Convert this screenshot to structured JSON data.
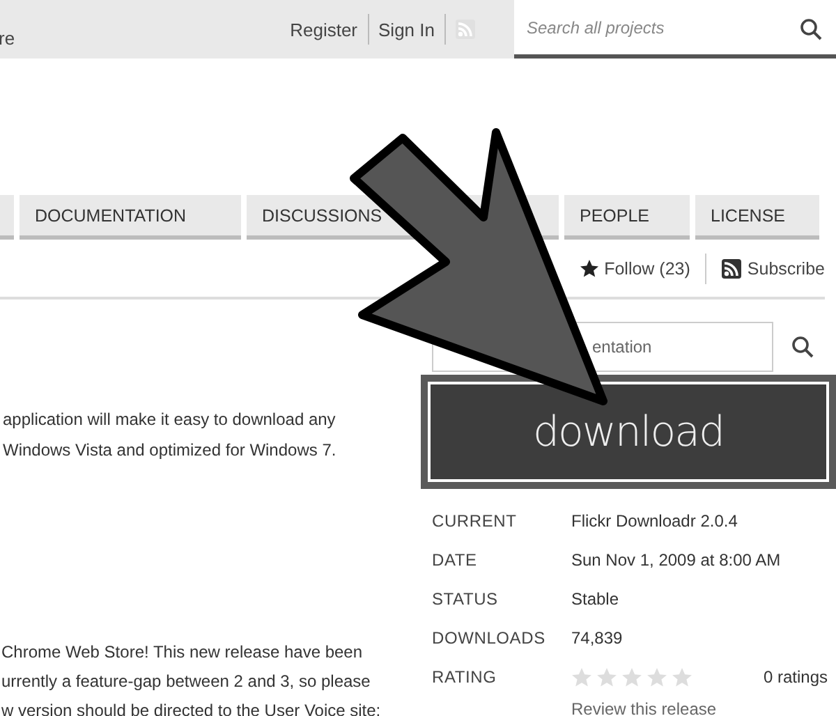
{
  "header": {
    "site_fragment": "re",
    "links": [
      "Register",
      "Sign In"
    ],
    "search": {
      "placeholder": "Search all projects"
    }
  },
  "tabs": [
    {
      "kind": "clipped"
    },
    {
      "kind": "tab",
      "label": "DOCUMENTATION"
    },
    {
      "kind": "tab",
      "label": "DISCUSSIONS"
    },
    {
      "kind": "tab",
      "label": "PEOPLE"
    },
    {
      "kind": "tab",
      "label": "LICENSE"
    }
  ],
  "actions": {
    "follow": "Follow (23)",
    "subscribe": "Subscribe"
  },
  "description": [
    [
      "application will make it easy to download any",
      "Windows Vista and optimized for Windows 7."
    ],
    [
      "Chrome Web Store! This new release have been",
      "urrently a feature-gap between 2 and 3, so please",
      "w version should be directed to the User Voice site:"
    ]
  ],
  "doc_search": {
    "placeholder": "entation"
  },
  "download_button": "download",
  "release": {
    "rows": [
      {
        "label": "CURRENT",
        "value": "Flickr Downloadr 2.0.4"
      },
      {
        "label": "DATE",
        "value": "Sun Nov 1, 2009 at 8:00 AM"
      },
      {
        "label": "STATUS",
        "value": "Stable"
      },
      {
        "label": "DOWNLOADS",
        "value": "74,839"
      }
    ],
    "rating": {
      "label": "RATING",
      "stars": 0,
      "count": "0 ratings",
      "review_link": "Review this release"
    }
  }
}
